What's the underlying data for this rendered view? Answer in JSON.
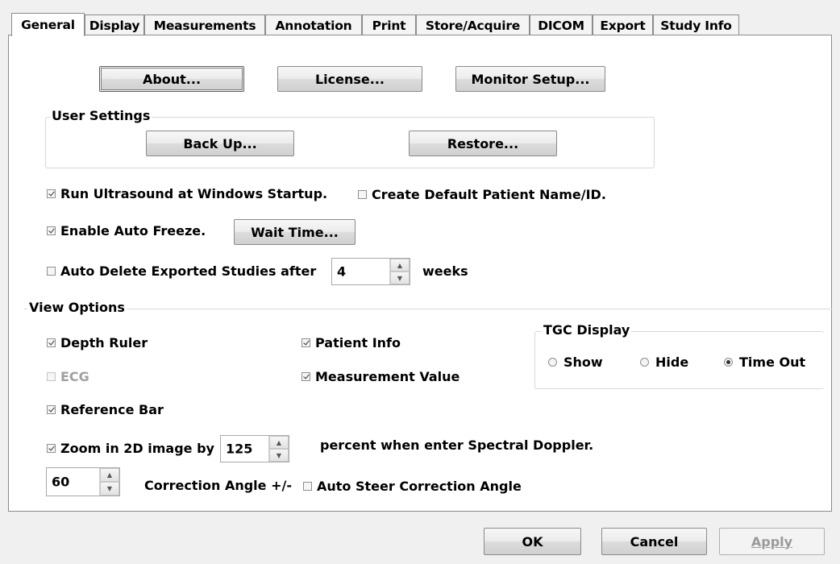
{
  "tabs": [
    "General",
    "Display",
    "Measurements",
    "Annotation",
    "Print",
    "Store/Acquire",
    "DICOM",
    "Export",
    "Study Info"
  ],
  "buttons": {
    "about": "About...",
    "license": "License...",
    "monitor_setup": "Monitor Setup...",
    "back_up": "Back Up...",
    "restore": "Restore...",
    "wait_time": "Wait Time..."
  },
  "user_settings": {
    "title": "User Settings"
  },
  "options": {
    "run_startup": "Run Ultrasound at Windows Startup.",
    "create_default": "Create Default Patient Name/ID.",
    "auto_freeze": "Enable Auto Freeze.",
    "auto_delete": "Auto Delete Exported Studies after",
    "auto_delete_value": "4",
    "weeks": "weeks"
  },
  "view_options": {
    "title": "View Options",
    "depth_ruler": "Depth Ruler",
    "patient_info": "Patient Info",
    "ecg": "ECG",
    "measurement_value": "Measurement Value",
    "reference_bar": "Reference Bar",
    "zoom": "Zoom in 2D image by",
    "zoom_value": "125",
    "zoom_suffix": "percent when enter Spectral Doppler.",
    "angle_value": "60",
    "correction_angle": "Correction Angle +/-",
    "auto_steer": "Auto Steer Correction Angle"
  },
  "tgc": {
    "title": "TGC Display",
    "show": "Show",
    "hide": "Hide",
    "time_out": "Time Out"
  },
  "footer": {
    "ok": "OK",
    "cancel": "Cancel",
    "apply": "Apply"
  }
}
